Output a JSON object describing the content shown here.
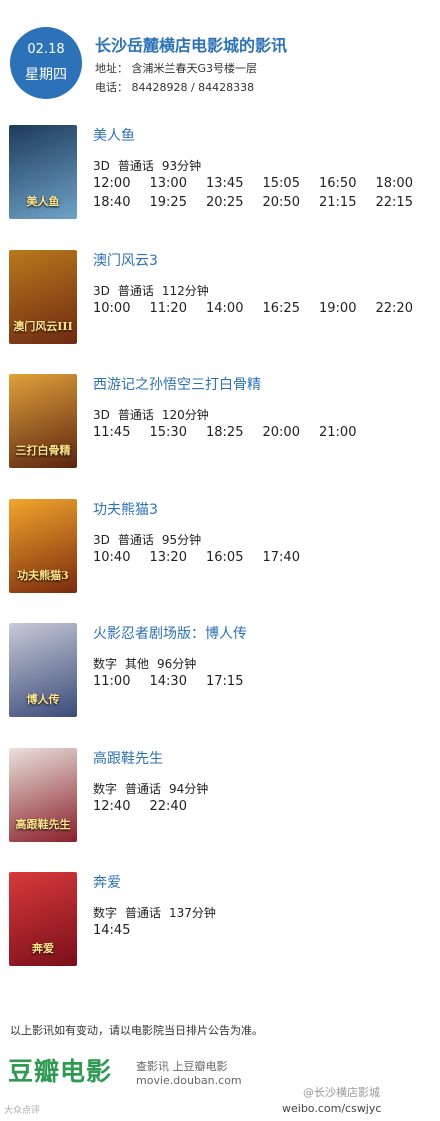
{
  "header": {
    "date": "02.18",
    "weekday": "星期四",
    "cinema_name": "长沙岳麓横店电影城的影讯",
    "address": "地址： 含浦米兰春天G3号楼一层",
    "phone": "电话： 84428928 / 84428338"
  },
  "colors": {
    "accent": "#2b72b9",
    "brand": "#2f9a52"
  },
  "movies": [
    {
      "title": "美人鱼",
      "format": "3D",
      "language": "普通话",
      "duration": "93分钟",
      "poster_caption": "美人鱼",
      "poster_colors": [
        "#1d3a5a",
        "#6fa3c9"
      ],
      "times": [
        "12:00",
        "13:00",
        "13:45",
        "15:05",
        "16:50",
        "18:00",
        "18:40",
        "19:25",
        "20:25",
        "20:50",
        "21:15",
        "22:15"
      ]
    },
    {
      "title": "澳门风云3",
      "format": "3D",
      "language": "普通话",
      "duration": "112分钟",
      "poster_caption": "澳门风云III",
      "poster_colors": [
        "#b8791c",
        "#6e2a12"
      ],
      "times": [
        "10:00",
        "11:20",
        "14:00",
        "16:25",
        "19:00",
        "22:20"
      ]
    },
    {
      "title": "西游记之孙悟空三打白骨精",
      "format": "3D",
      "language": "普通话",
      "duration": "120分钟",
      "poster_caption": "三打白骨精",
      "poster_colors": [
        "#e0a13a",
        "#5a2410"
      ],
      "times": [
        "11:45",
        "15:30",
        "18:25",
        "20:00",
        "21:00"
      ]
    },
    {
      "title": "功夫熊猫3",
      "format": "3D",
      "language": "普通话",
      "duration": "95分钟",
      "poster_caption": "功夫熊猫3",
      "poster_colors": [
        "#f2a62b",
        "#7a2a0e"
      ],
      "times": [
        "10:40",
        "13:20",
        "16:05",
        "17:40"
      ]
    },
    {
      "title": "火影忍者剧场版：博人传",
      "format": "数字",
      "language": "其他",
      "duration": "96分钟",
      "poster_caption": "博人传",
      "poster_colors": [
        "#c7cbd6",
        "#3b4a7a"
      ],
      "times": [
        "11:00",
        "14:30",
        "17:15"
      ]
    },
    {
      "title": "高跟鞋先生",
      "format": "数字",
      "language": "普通话",
      "duration": "94分钟",
      "poster_caption": "高跟鞋先生",
      "poster_colors": [
        "#e9e2dc",
        "#8a1f2a"
      ],
      "times": [
        "12:40",
        "22:40"
      ]
    },
    {
      "title": "奔爱",
      "format": "数字",
      "language": "普通话",
      "duration": "137分钟",
      "poster_caption": "奔爱",
      "poster_colors": [
        "#d83a3a",
        "#7a0f1a"
      ],
      "times": [
        "14:45"
      ]
    }
  ],
  "footer": {
    "notice": "以上影讯如有变动，请以电影院当日排片公告为准。",
    "brand_logo": "豆瓣电影",
    "brand_slogan": "查影讯 上豆瓣电影",
    "brand_url": "movie.douban.com",
    "weibo_watermark": "@长沙横店影城",
    "weibo_url": "weibo.com/cswjyc",
    "corner_logo": "大众点评"
  }
}
